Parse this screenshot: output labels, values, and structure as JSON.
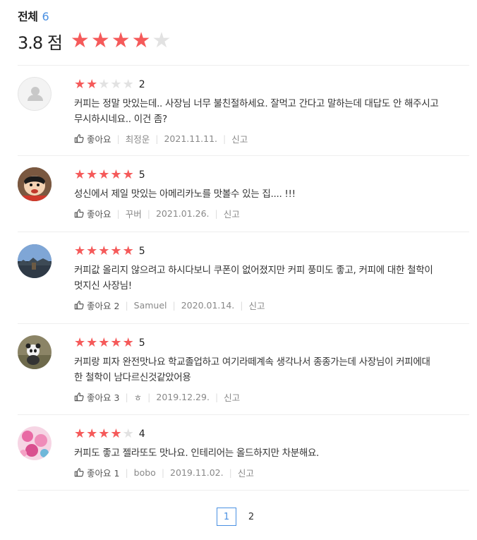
{
  "header": {
    "label": "전체",
    "count": "6"
  },
  "rating": {
    "score": "3.8",
    "unit": "점",
    "stars_filled": 4,
    "stars_total": 5
  },
  "colors": {
    "star_on": "#f55a5a",
    "star_off": "#e2e2e2",
    "accent": "#4a90e2"
  },
  "reviews": [
    {
      "stars": 2,
      "rating": "2",
      "text": "커피는 정말 맛있는데.. 사장님 너무 불친절하세요. 잘먹고 간다고 말하는데 대답도 안 해주시고",
      "text2": "무시하시네요.. 이건 좀?",
      "like": "좋아요",
      "author": "최정운",
      "date": "2021.11.11.",
      "report": "신고",
      "avatar": "default-user-icon"
    },
    {
      "stars": 5,
      "rating": "5",
      "text": "성신에서 제일 맛있는 아메리카노를 맛볼수 있는 집.... !!!",
      "like": "좋아요",
      "author": "꾸버",
      "date": "2021.01.26.",
      "report": "신고",
      "avatar": "cartoon-avatar"
    },
    {
      "stars": 5,
      "rating": "5",
      "text": "커피값 올리지 않으려고 하시다보니 쿠폰이 없어졌지만 커피 풍미도 좋고, 커피에 대한 철학이",
      "text2": "멋지신 사장님!",
      "like": "좋아요 2",
      "author": "Samuel",
      "date": "2020.01.14.",
      "report": "신고",
      "avatar": "landscape-avatar"
    },
    {
      "stars": 5,
      "rating": "5",
      "text": "커피랑 피자 완전맛나요  학교졸업하고 여기라떼계속 생각나서 종종가는데  사장님이 커피에대",
      "text2": "한 철학이 남다르신것같았어용",
      "like": "좋아요 3",
      "author": "ㅎ",
      "date": "2019.12.29.",
      "report": "신고",
      "avatar": "panda-avatar"
    },
    {
      "stars": 4,
      "rating": "4",
      "text": "커피도 좋고 젤라또도 맛나요. 인테리어는 올드하지만 차분해요.",
      "like": "좋아요 1",
      "author": "bobo",
      "date": "2019.11.02.",
      "report": "신고",
      "avatar": "flowers-avatar"
    }
  ],
  "pagination": {
    "pages": [
      "1",
      "2"
    ],
    "current": "1"
  }
}
